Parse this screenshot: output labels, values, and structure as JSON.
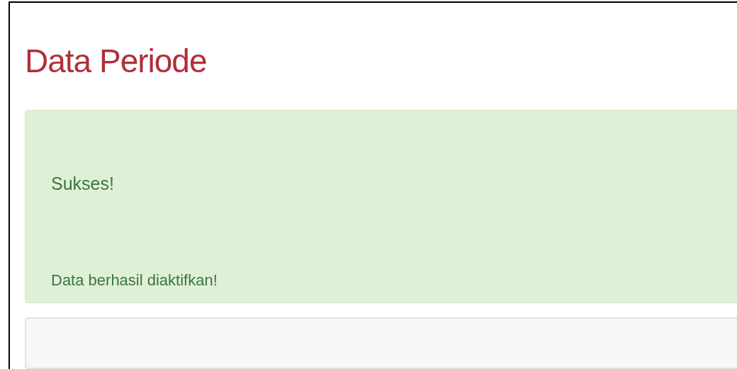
{
  "page": {
    "title": "Data Periode"
  },
  "alert": {
    "kind": "success",
    "heading": "Sukses!",
    "message": "Data berhasil diaktifkan!"
  }
}
